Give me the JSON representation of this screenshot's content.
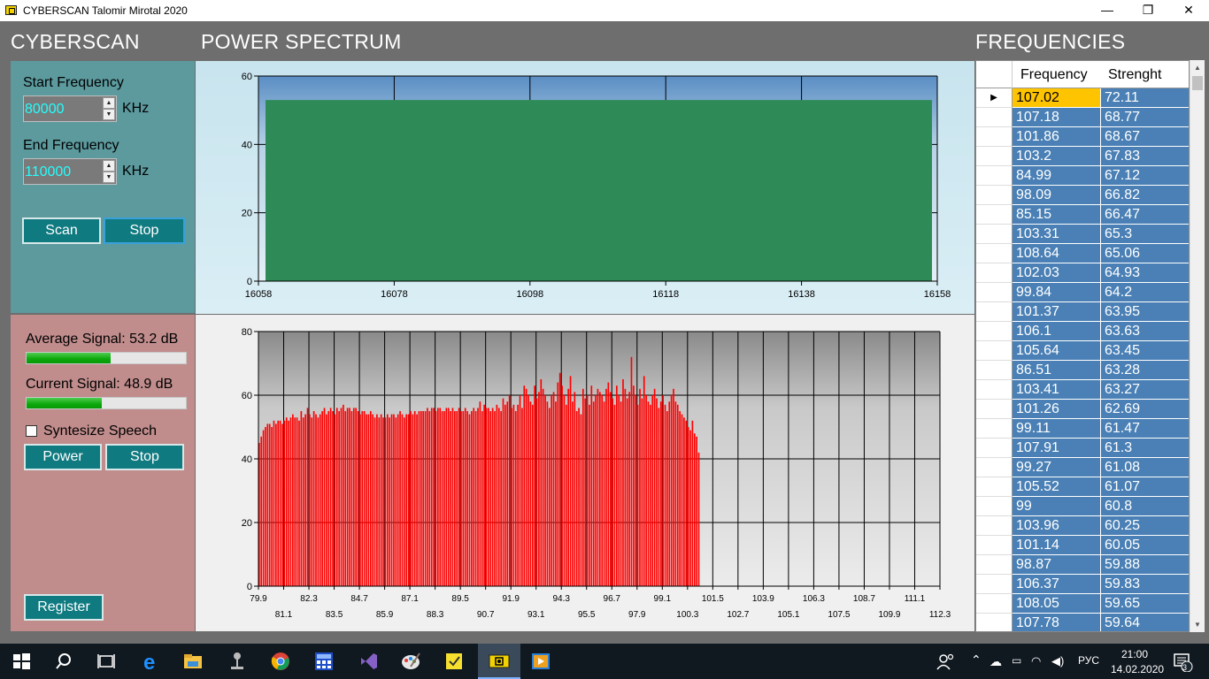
{
  "window": {
    "title": "CYBERSCAN Talomir Mirotal 2020",
    "minimize": "—",
    "maximize": "❐",
    "close": "✕"
  },
  "headers": {
    "app": "CYBERSCAN",
    "spectrum": "POWER SPECTRUM",
    "frequencies": "FREQUENCIES"
  },
  "scan_panel": {
    "start_label": "Start Frequency",
    "start_value": "80000",
    "end_label": "End Frequency",
    "end_value": "110000",
    "unit": "KHz",
    "scan_button": "Scan",
    "stop_button": "Stop"
  },
  "signal_panel": {
    "average_label": "Average Signal: 53.2 dB",
    "average_fraction": 0.53,
    "current_label": "Current Signal: 48.9 dB",
    "current_fraction": 0.47,
    "speech_label": "Syntesize Speech",
    "speech_checked": false,
    "power_button": "Power",
    "stop_button": "Stop",
    "register_button": "Register"
  },
  "chart_data": [
    {
      "type": "area",
      "x": [
        16058,
        16158
      ],
      "y": [
        53,
        53
      ],
      "xticks": [
        "16058",
        "16078",
        "16098",
        "16118",
        "16138",
        "16158"
      ],
      "yticks": [
        "0",
        "20",
        "40",
        "60"
      ],
      "xlim": [
        16058,
        16158
      ],
      "ylim": [
        0,
        60
      ],
      "grid": true,
      "series_color": "#2e8b57"
    },
    {
      "type": "bar",
      "xlim": [
        79.9,
        112.3
      ],
      "ylim": [
        0,
        80
      ],
      "xticks_upper": [
        "79.9",
        "82.3",
        "84.7",
        "87.1",
        "89.5",
        "91.9",
        "94.3",
        "96.7",
        "99.1",
        "101.5",
        "103.9",
        "106.3",
        "108.7",
        "111.1"
      ],
      "xticks_lower": [
        "81.1",
        "83.5",
        "85.9",
        "88.3",
        "90.7",
        "93.1",
        "95.5",
        "97.9",
        "100.3",
        "102.7",
        "105.1",
        "107.5",
        "109.9",
        "112.3"
      ],
      "yticks": [
        "0",
        "20",
        "40",
        "60",
        "80"
      ],
      "x_start": 79.9,
      "x_step": 0.1,
      "values": [
        45,
        47,
        49,
        50,
        51,
        51,
        50,
        52,
        51,
        52,
        52,
        51,
        52,
        53,
        52,
        53,
        54,
        53,
        53,
        52,
        55,
        53,
        54,
        56,
        54,
        53,
        55,
        54,
        53,
        54,
        55,
        56,
        54,
        55,
        56,
        55,
        54,
        56,
        55,
        56,
        57,
        55,
        56,
        56,
        55,
        56,
        56,
        55,
        54,
        55,
        55,
        54,
        54,
        55,
        54,
        53,
        54,
        53,
        54,
        53,
        53,
        54,
        53,
        54,
        54,
        53,
        54,
        55,
        54,
        53,
        54,
        54,
        55,
        54,
        55,
        54,
        55,
        55,
        55,
        55,
        56,
        55,
        56,
        56,
        55,
        56,
        56,
        55,
        55,
        56,
        56,
        55,
        56,
        55,
        55,
        56,
        55,
        55,
        56,
        55,
        54,
        55,
        56,
        55,
        56,
        58,
        55,
        57,
        56,
        56,
        55,
        56,
        55,
        57,
        56,
        55,
        59,
        57,
        58,
        60,
        56,
        57,
        55,
        57,
        60,
        56,
        63,
        62,
        60,
        58,
        57,
        63,
        59,
        61,
        65,
        62,
        60,
        58,
        56,
        60,
        61,
        58,
        64,
        67,
        63,
        60,
        57,
        62,
        66,
        58,
        61,
        55,
        56,
        54,
        62,
        59,
        60,
        57,
        63,
        58,
        60,
        62,
        61,
        60,
        58,
        62,
        64,
        61,
        59,
        57,
        63,
        60,
        58,
        65,
        62,
        59,
        61,
        72,
        63,
        60,
        57,
        62,
        59,
        66,
        60,
        58,
        57,
        60,
        62,
        59,
        56,
        58,
        60,
        57,
        55,
        58,
        60,
        62,
        58,
        57,
        55,
        54,
        53,
        52,
        50,
        49,
        52,
        48,
        47,
        42
      ],
      "series_color": "#ff0000"
    }
  ],
  "frequency_table": {
    "columns": [
      "Frequency",
      "Strenght"
    ],
    "rows": [
      [
        "107.02",
        "72.11"
      ],
      [
        "107.18",
        "68.77"
      ],
      [
        "101.86",
        "68.67"
      ],
      [
        "103.2",
        "67.83"
      ],
      [
        "84.99",
        "67.12"
      ],
      [
        "98.09",
        "66.82"
      ],
      [
        "85.15",
        "66.47"
      ],
      [
        "103.31",
        "65.3"
      ],
      [
        "108.64",
        "65.06"
      ],
      [
        "102.03",
        "64.93"
      ],
      [
        "99.84",
        "64.2"
      ],
      [
        "101.37",
        "63.95"
      ],
      [
        "106.1",
        "63.63"
      ],
      [
        "105.64",
        "63.45"
      ],
      [
        "86.51",
        "63.28"
      ],
      [
        "103.41",
        "63.27"
      ],
      [
        "101.26",
        "62.69"
      ],
      [
        "99.11",
        "61.47"
      ],
      [
        "107.91",
        "61.3"
      ],
      [
        "99.27",
        "61.08"
      ],
      [
        "105.52",
        "61.07"
      ],
      [
        "99",
        "60.8"
      ],
      [
        "103.96",
        "60.25"
      ],
      [
        "101.14",
        "60.05"
      ],
      [
        "98.87",
        "59.88"
      ],
      [
        "106.37",
        "59.83"
      ],
      [
        "108.05",
        "59.65"
      ],
      [
        "107.78",
        "59.64"
      ]
    ]
  },
  "taskbar": {
    "language": "РУС",
    "time": "21:00",
    "date": "14.02.2020",
    "notifications": "3"
  }
}
